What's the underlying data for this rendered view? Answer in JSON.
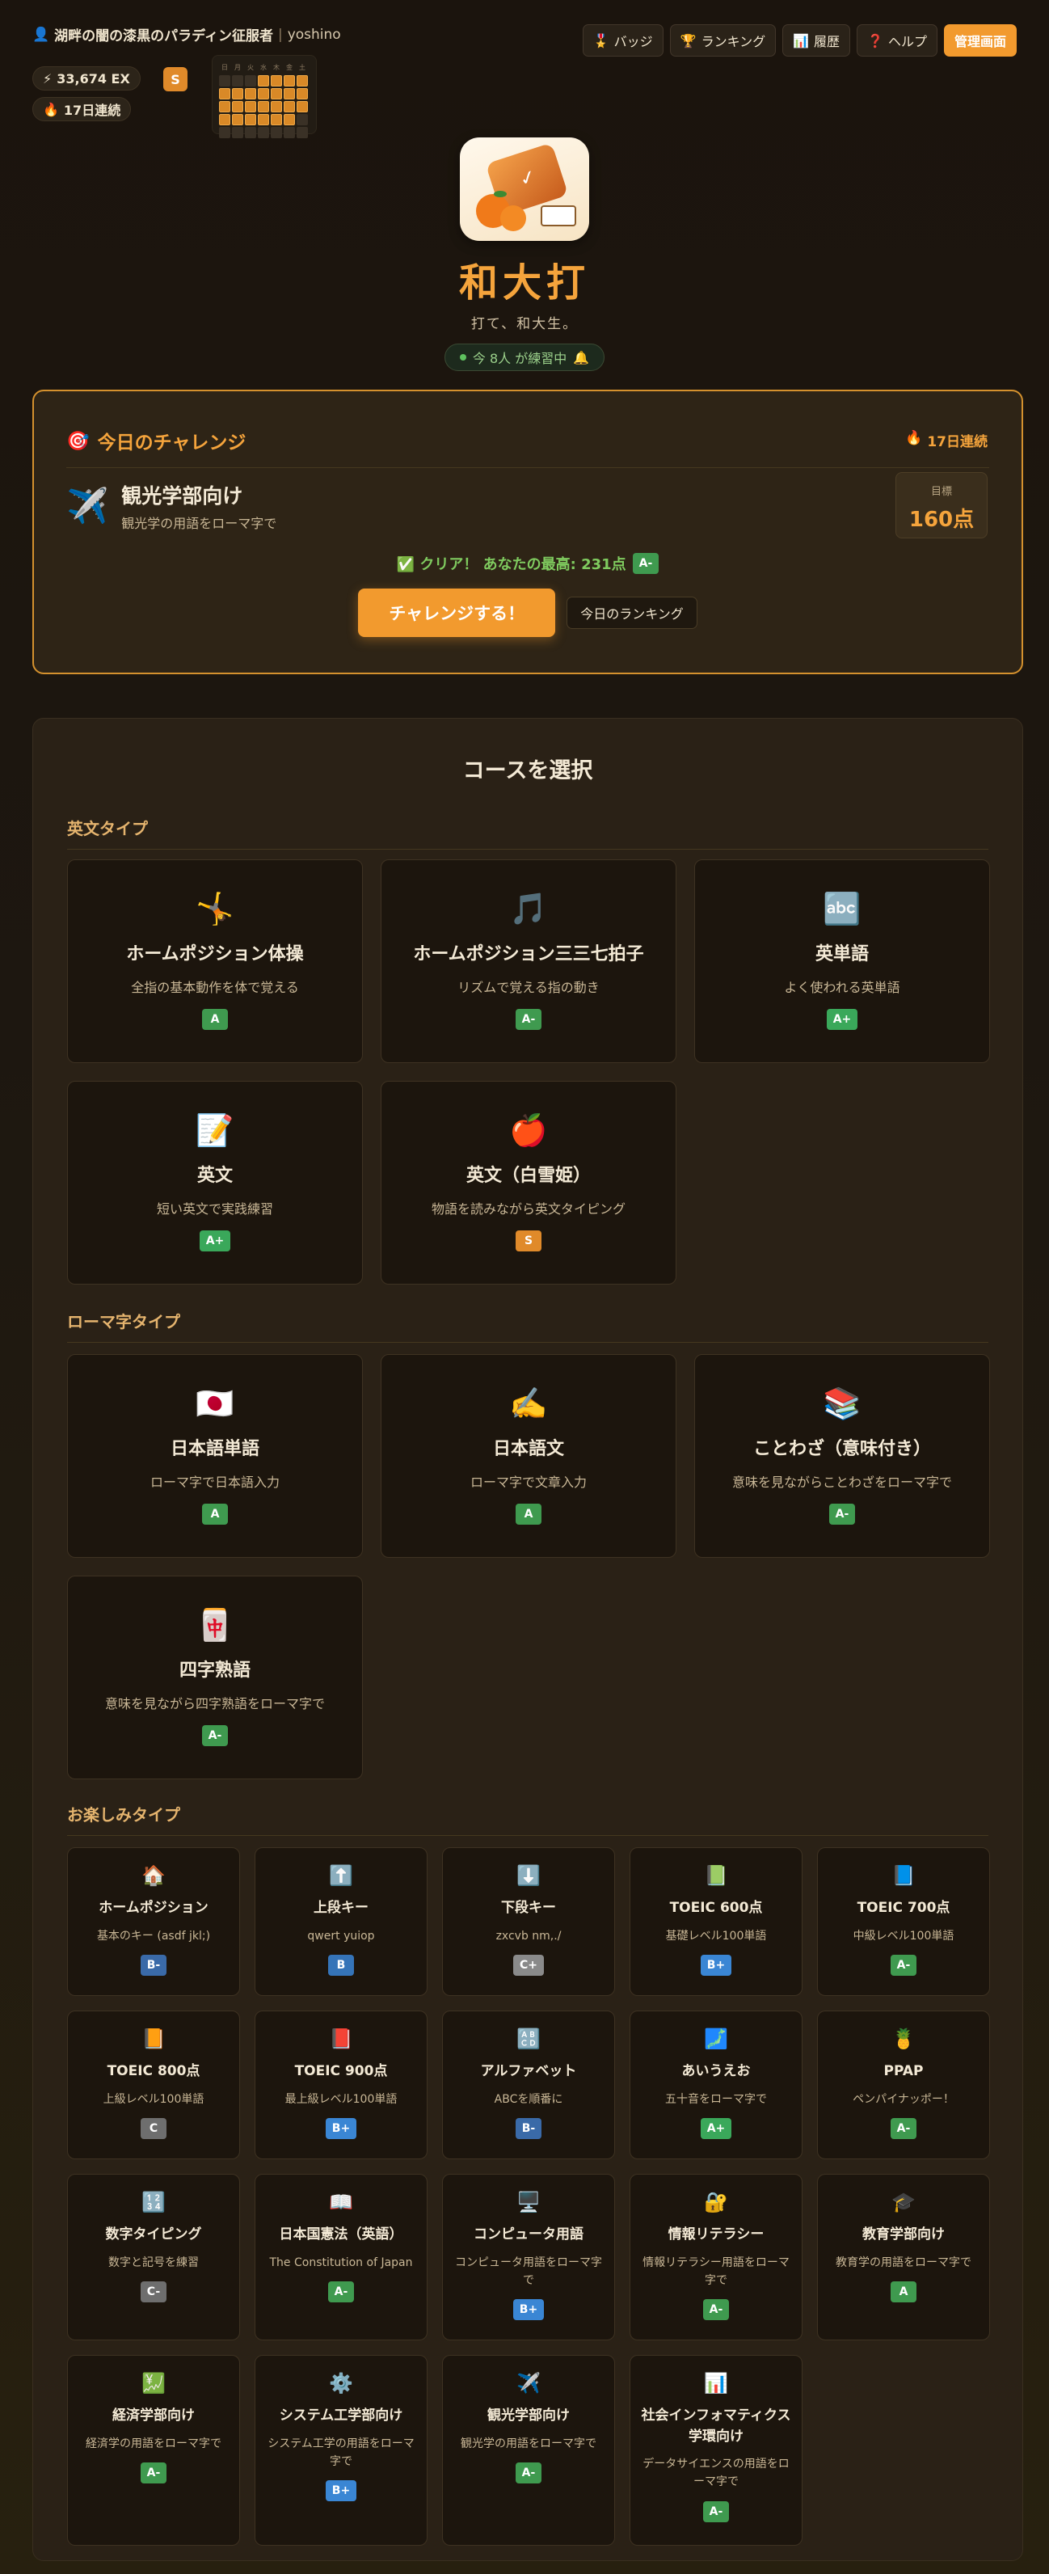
{
  "user": {
    "icon": "👤",
    "title": "湖畔の闇の漆黒のパラディン征服者",
    "separator": "|",
    "name": "yoshino"
  },
  "stats": {
    "ex_icon": "⚡",
    "ex": "33,674 EX",
    "rank": "S",
    "streak_icon": "🔥",
    "streak": "17日連続"
  },
  "heatmap": {
    "day_headers": [
      "日",
      "月",
      "火",
      "水",
      "木",
      "金",
      "土"
    ],
    "weeks": [
      [
        0,
        0,
        0,
        1,
        1,
        1,
        1
      ],
      [
        1,
        1,
        1,
        1,
        1,
        1,
        1
      ],
      [
        1,
        1,
        1,
        1,
        1,
        1,
        1
      ],
      [
        1,
        1,
        1,
        1,
        1,
        1,
        0
      ],
      [
        0,
        0,
        0,
        0,
        0,
        0,
        0
      ]
    ]
  },
  "nav": [
    {
      "icon": "🎖️",
      "label": "バッジ",
      "name": "nav-badges"
    },
    {
      "icon": "🏆",
      "label": "ランキング",
      "name": "nav-ranking"
    },
    {
      "icon": "📊",
      "label": "履歴",
      "name": "nav-history"
    },
    {
      "icon": "❓",
      "label": "ヘルプ",
      "name": "nav-help"
    }
  ],
  "admin_label": "管理画面",
  "hero": {
    "title": "和大打",
    "tagline": "打て、和大生。",
    "online": "今 8人 が練習中",
    "bell": "🔔"
  },
  "challenge": {
    "icon": "🎯",
    "title": "今日のチャレンジ",
    "streak_icon": "🔥",
    "streak": "17日連続",
    "course_icon": "✈️",
    "course_title": "観光学部向け",
    "course_desc": "観光学の用語をローマ字で",
    "goal_label": "目標",
    "goal_value": "160点",
    "clear_text": "✅ クリア！ あなたの最高: 231点",
    "clear_grade": "A-",
    "cta": "チャレンジする！",
    "ranking": "今日のランキング"
  },
  "courses_title": "コースを選択",
  "categories": {
    "english": "英文タイプ",
    "romaji": "ローマ字タイプ",
    "fun": "お楽しみタイプ"
  },
  "grade_colors": {
    "A+": "#3aa85a",
    "A": "#3f9a4f",
    "A-": "#3f9a4f",
    "S": "#e08a2a",
    "B+": "#3a86d4",
    "B": "#3574b8",
    "B-": "#3a6aa8",
    "C+": "#8a8a8a",
    "C": "#6e6e6e",
    "C-": "#6e6e6e"
  },
  "english_courses": [
    {
      "icon": "🤸",
      "title": "ホームポジション体操",
      "desc": "全指の基本動作を体で覚える",
      "grade": "A"
    },
    {
      "icon": "🎵",
      "title": "ホームポジション三三七拍子",
      "desc": "リズムで覚える指の動き",
      "grade": "A-"
    },
    {
      "icon": "🔤",
      "title": "英単語",
      "desc": "よく使われる英単語",
      "grade": "A+"
    },
    {
      "icon": "📝",
      "title": "英文",
      "desc": "短い英文で実践練習",
      "grade": "A+"
    },
    {
      "icon": "🍎",
      "title": "英文（白雪姫）",
      "desc": "物語を読みながら英文タイピング",
      "grade": "S"
    }
  ],
  "romaji_courses": [
    {
      "icon": "🇯🇵",
      "title": "日本語単語",
      "desc": "ローマ字で日本語入力",
      "grade": "A"
    },
    {
      "icon": "✍️",
      "title": "日本語文",
      "desc": "ローマ字で文章入力",
      "grade": "A"
    },
    {
      "icon": "📚",
      "title": "ことわざ（意味付き）",
      "desc": "意味を見ながらことわざをローマ字で",
      "grade": "A-"
    },
    {
      "icon": "🀄",
      "title": "四字熟語",
      "desc": "意味を見ながら四字熟語をローマ字で",
      "grade": "A-"
    }
  ],
  "fun_courses": [
    {
      "icon": "🏠",
      "title": "ホームポジション",
      "desc": "基本のキー (asdf jkl;)",
      "grade": "B-"
    },
    {
      "icon": "⬆️",
      "title": "上段キー",
      "desc": "qwert yuiop",
      "grade": "B"
    },
    {
      "icon": "⬇️",
      "title": "下段キー",
      "desc": "zxcvb nm,./",
      "grade": "C+"
    },
    {
      "icon": "📗",
      "title": "TOEIC 600点",
      "desc": "基礎レベル100単語",
      "grade": "B+"
    },
    {
      "icon": "📘",
      "title": "TOEIC 700点",
      "desc": "中級レベル100単語",
      "grade": "A-"
    },
    {
      "icon": "📙",
      "title": "TOEIC 800点",
      "desc": "上級レベル100単語",
      "grade": "C"
    },
    {
      "icon": "📕",
      "title": "TOEIC 900点",
      "desc": "最上級レベル100単語",
      "grade": "B+"
    },
    {
      "icon": "🔠",
      "title": "アルファベット",
      "desc": "ABCを順番に",
      "grade": "B-"
    },
    {
      "icon": "🗾",
      "title": "あいうえお",
      "desc": "五十音をローマ字で",
      "grade": "A+"
    },
    {
      "icon": "🍍",
      "title": "PPAP",
      "desc": "ペンパイナッポー！",
      "grade": "A-"
    },
    {
      "icon": "🔢",
      "title": "数字タイピング",
      "desc": "数字と記号を練習",
      "grade": "C-"
    },
    {
      "icon": "📖",
      "title": "日本国憲法（英語）",
      "desc": "The Constitution of Japan",
      "grade": "A-"
    },
    {
      "icon": "🖥️",
      "title": "コンピュータ用語",
      "desc": "コンピュータ用語をローマ字で",
      "grade": "B+"
    },
    {
      "icon": "🔐",
      "title": "情報リテラシー",
      "desc": "情報リテラシー用語をローマ字で",
      "grade": "A-"
    },
    {
      "icon": "🎓",
      "title": "教育学部向け",
      "desc": "教育学の用語をローマ字で",
      "grade": "A"
    },
    {
      "icon": "💹",
      "title": "経済学部向け",
      "desc": "経済学の用語をローマ字で",
      "grade": "A-"
    },
    {
      "icon": "⚙️",
      "title": "システム工学部向け",
      "desc": "システム工学の用語をローマ字で",
      "grade": "B+"
    },
    {
      "icon": "✈️",
      "title": "観光学部向け",
      "desc": "観光学の用語をローマ字で",
      "grade": "A-"
    },
    {
      "icon": "📊",
      "title": "社会インフォマティクス学環向け",
      "desc": "データサイエンスの用語をローマ字で",
      "grade": "A-"
    }
  ]
}
